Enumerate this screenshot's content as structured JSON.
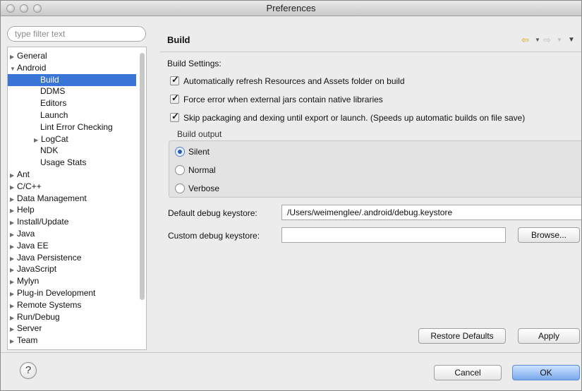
{
  "window": {
    "title": "Preferences"
  },
  "tree": {
    "filter_placeholder": "type filter text",
    "items": [
      {
        "label": "General",
        "arrow": "▶",
        "indent": 0
      },
      {
        "label": "Android",
        "arrow": "▼",
        "indent": 0
      },
      {
        "label": "Build",
        "arrow": "",
        "indent": 1,
        "selected": true
      },
      {
        "label": "DDMS",
        "arrow": "",
        "indent": 1
      },
      {
        "label": "Editors",
        "arrow": "",
        "indent": 1
      },
      {
        "label": "Launch",
        "arrow": "",
        "indent": 1
      },
      {
        "label": "Lint Error Checking",
        "arrow": "",
        "indent": 1
      },
      {
        "label": "LogCat",
        "arrow": "▶",
        "indent": 1
      },
      {
        "label": "NDK",
        "arrow": "",
        "indent": 1
      },
      {
        "label": "Usage Stats",
        "arrow": "",
        "indent": 1
      },
      {
        "label": "Ant",
        "arrow": "▶",
        "indent": 0
      },
      {
        "label": "C/C++",
        "arrow": "▶",
        "indent": 0
      },
      {
        "label": "Data Management",
        "arrow": "▶",
        "indent": 0
      },
      {
        "label": "Help",
        "arrow": "▶",
        "indent": 0
      },
      {
        "label": "Install/Update",
        "arrow": "▶",
        "indent": 0
      },
      {
        "label": "Java",
        "arrow": "▶",
        "indent": 0
      },
      {
        "label": "Java EE",
        "arrow": "▶",
        "indent": 0
      },
      {
        "label": "Java Persistence",
        "arrow": "▶",
        "indent": 0
      },
      {
        "label": "JavaScript",
        "arrow": "▶",
        "indent": 0
      },
      {
        "label": "Mylyn",
        "arrow": "▶",
        "indent": 0
      },
      {
        "label": "Plug-in Development",
        "arrow": "▶",
        "indent": 0
      },
      {
        "label": "Remote Systems",
        "arrow": "▶",
        "indent": 0
      },
      {
        "label": "Run/Debug",
        "arrow": "▶",
        "indent": 0
      },
      {
        "label": "Server",
        "arrow": "▶",
        "indent": 0
      },
      {
        "label": "Team",
        "arrow": "▶",
        "indent": 0
      }
    ]
  },
  "page": {
    "title": "Build",
    "nav_back_icon": "⇦",
    "nav_forward_icon": "⇨",
    "menu_icon": "▼",
    "build_settings_label": "Build Settings:",
    "options": [
      {
        "label": "Automatically refresh Resources and Assets folder on build",
        "checked": true
      },
      {
        "label": "Force error when external jars contain native libraries",
        "checked": true
      },
      {
        "label": "Skip packaging and dexing until export or launch. (Speeds up automatic builds on file save)",
        "checked": true
      }
    ],
    "build_output": {
      "label": "Build output",
      "choices": [
        "Silent",
        "Normal",
        "Verbose"
      ],
      "selected": "Silent"
    },
    "default_keystore": {
      "label": "Default debug keystore:",
      "value": "/Users/weimenglee/.android/debug.keystore"
    },
    "custom_keystore": {
      "label": "Custom debug keystore:",
      "value": "",
      "browse": "Browse..."
    },
    "restore_defaults": "Restore Defaults",
    "apply": "Apply"
  },
  "footer": {
    "help_icon": "?",
    "cancel": "Cancel",
    "ok": "OK"
  },
  "colors": {
    "selection": "#3875d7",
    "nav_arrow": "#d9a514",
    "ok_button": "#77a8ec"
  }
}
